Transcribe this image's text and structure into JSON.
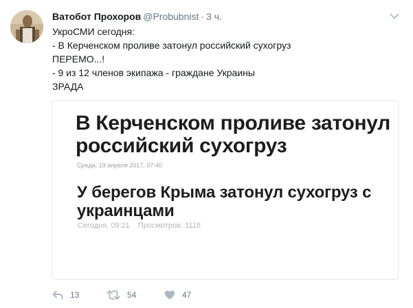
{
  "tweet": {
    "author_name": "Ватобот Прохоров",
    "author_handle": "@Probubnist",
    "time": "3 ч.",
    "lines": [
      "УкроСМИ сегодня:",
      "- В Керченском проливе затонул российский сухогруз",
      "ПЕРЕМО...!",
      "- 9 из 12 членов экипажа - граждане Украины",
      "ЗРАДА"
    ]
  },
  "card": {
    "headline1": "В Керченском проливе затонул российский сухогруз",
    "meta1": "Среда, 19 апреля 2017, 07:40",
    "headline2": "У берегов Крыма затонул сухогруз с украинцами",
    "meta2_date": "Сегодня, 09:21",
    "meta2_views": "Просмотров: 1118"
  },
  "actions": {
    "reply_count": "13",
    "retweet_count": "54",
    "like_count": "47"
  },
  "icons": {
    "reply": "reply-icon",
    "retweet": "retweet-icon",
    "like": "heart-icon",
    "menu": "chevron-down-icon"
  },
  "colors": {
    "text": "#14171a",
    "secondary": "#657786",
    "border": "#e1e8ed",
    "icon": "#aab8c2"
  }
}
